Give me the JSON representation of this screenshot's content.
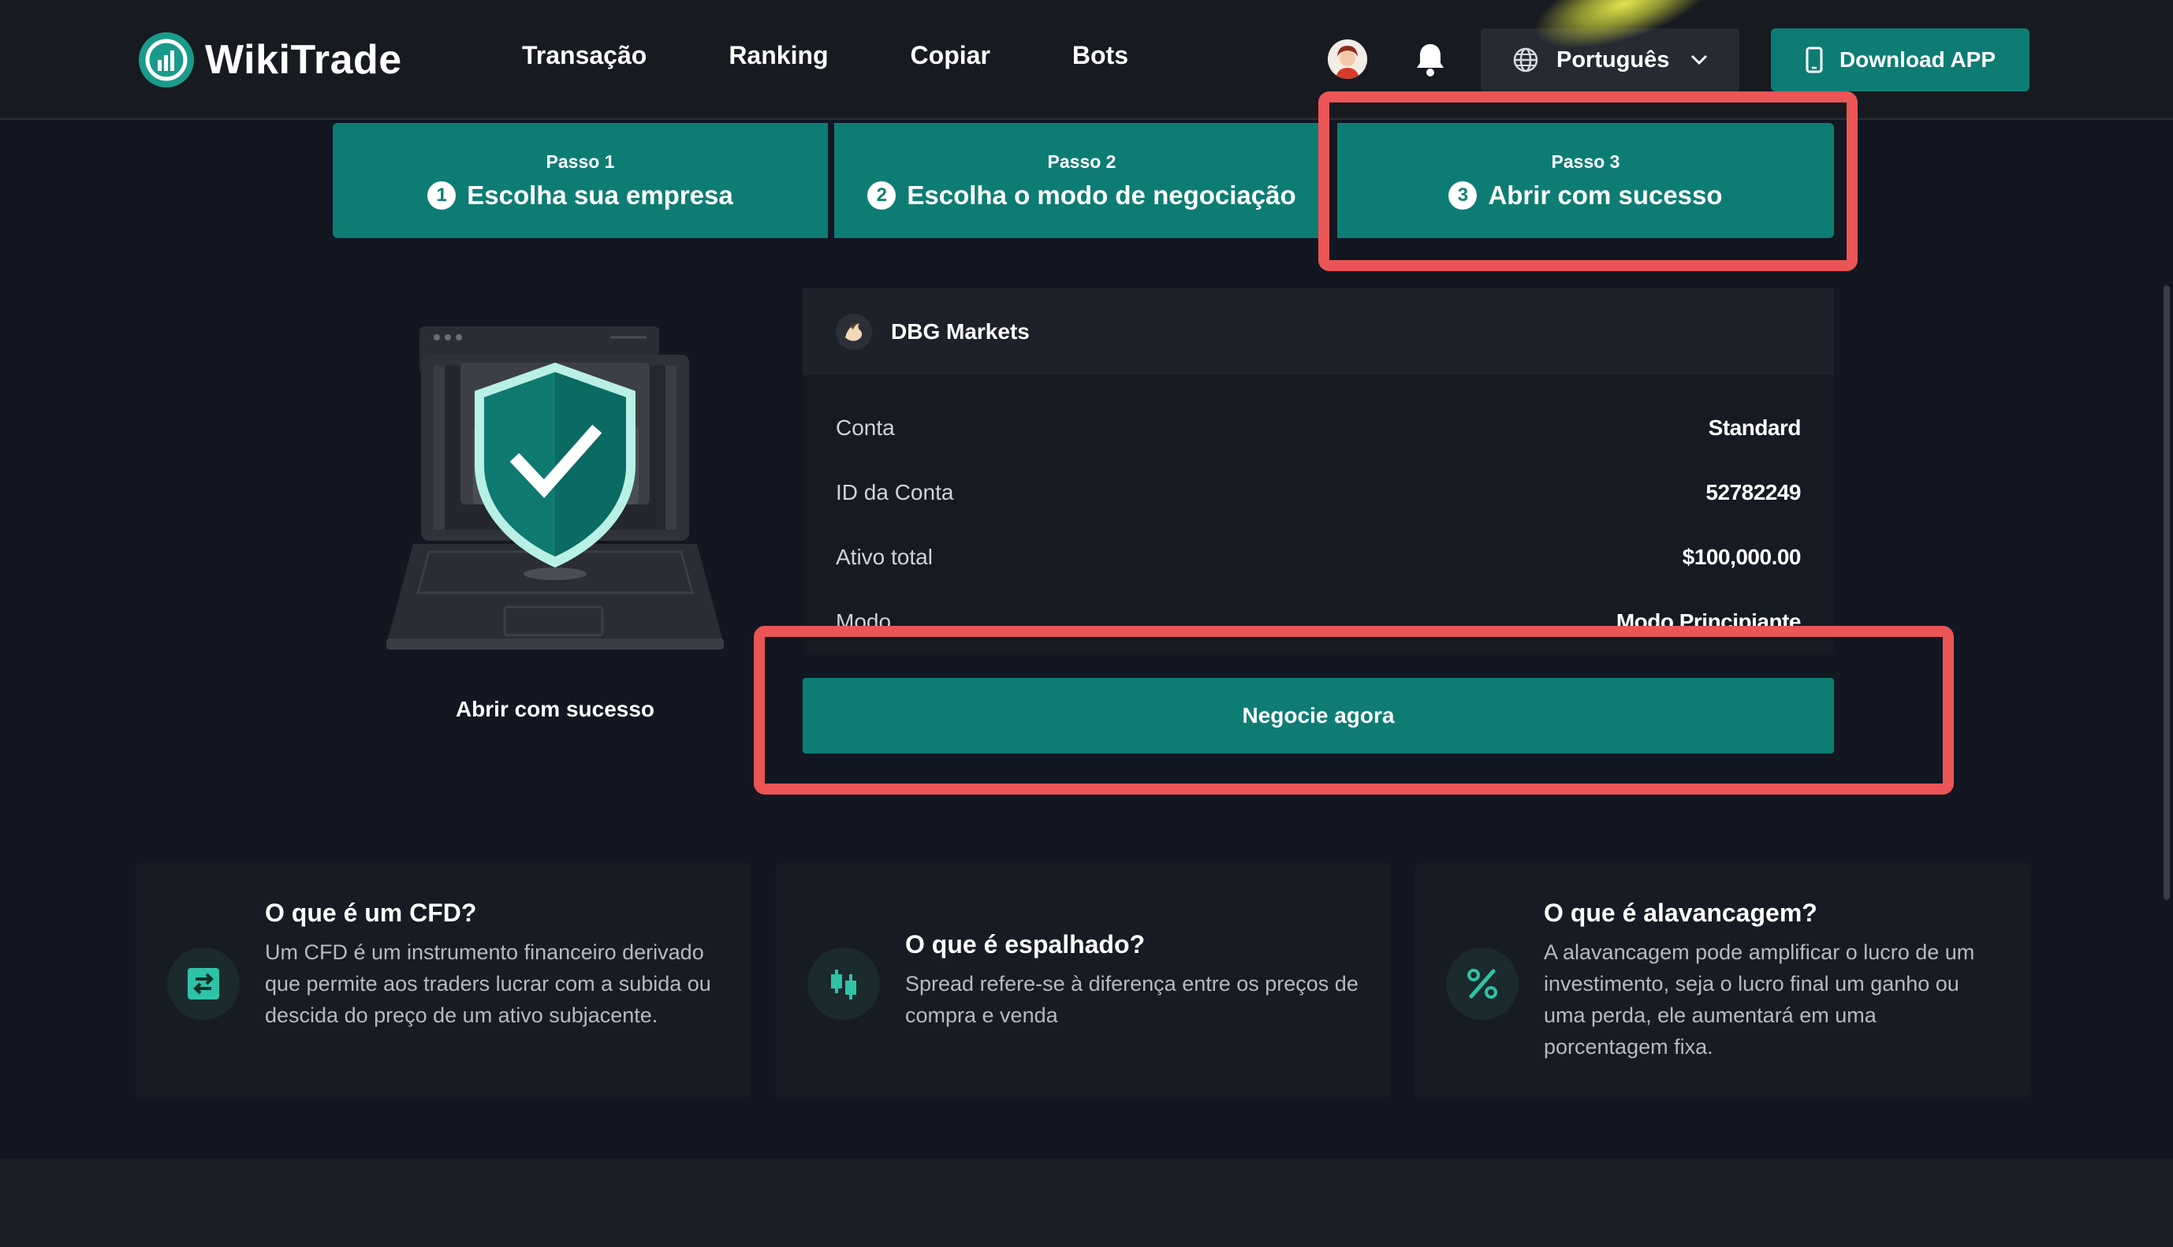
{
  "header": {
    "brand": "WikiTrade",
    "nav": [
      {
        "label": "Transação"
      },
      {
        "label": "Ranking"
      },
      {
        "label": "Copiar"
      },
      {
        "label": "Bots"
      }
    ],
    "language": "Português",
    "download_label": "Download APP",
    "icons": {
      "avatar": "avatar-icon",
      "bell": "bell-icon",
      "globe": "globe-icon",
      "chevron": "chevron-down-icon",
      "phone": "phone-icon"
    }
  },
  "steps": [
    {
      "small": "Passo 1",
      "num": "1",
      "label": "Escolha sua empresa"
    },
    {
      "small": "Passo 2",
      "num": "2",
      "label": "Escolha o modo de negociação"
    },
    {
      "small": "Passo 3",
      "num": "3",
      "label": "Abrir com sucesso"
    }
  ],
  "success": {
    "caption": "Abrir com sucesso"
  },
  "account": {
    "broker": "DBG Markets",
    "rows": [
      {
        "label": "Conta",
        "value": "Standard"
      },
      {
        "label": "ID da Conta",
        "value": "52782249"
      },
      {
        "label": "Ativo total",
        "value": "$100,000.00"
      },
      {
        "label": "Modo",
        "value": "Modo Principiante"
      }
    ],
    "trade_button": "Negocie agora"
  },
  "cards": [
    {
      "title": "O que é um CFD?",
      "text": "Um CFD é um instrumento financeiro derivado que permite aos traders lucrar com a subida ou descida do preço de um ativo subjacente.",
      "icon": "exchange-icon"
    },
    {
      "title": "O que é espalhado?",
      "text": "Spread refere-se à diferença entre os preços de compra e venda",
      "icon": "candlestick-icon"
    },
    {
      "title": "O que é alavancagem?",
      "text": "A alavancagem pode amplificar o lucro de um investimento, seja o lucro final um ganho ou uma perda, ele aumentará em uma porcentagem fixa.",
      "icon": "percent-icon"
    }
  ],
  "colors": {
    "accent": "#0d7d74",
    "highlight": "#eb5555",
    "background": "#121722"
  }
}
